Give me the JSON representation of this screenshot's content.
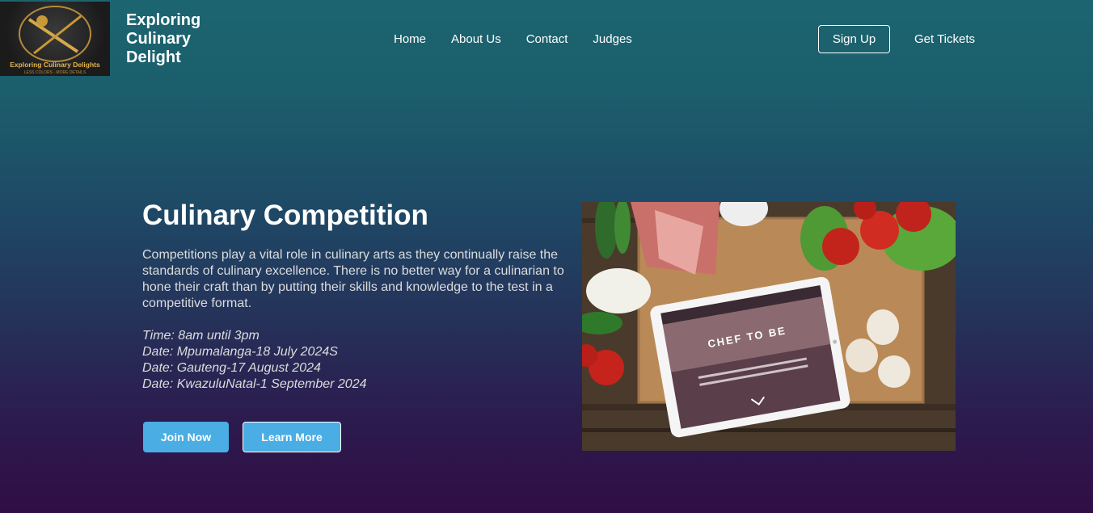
{
  "header": {
    "logo_text": "Exploring Culinary Delights",
    "logo_subtext": "LESS COLORS · MORE DETAILS",
    "brand_line1": "Exploring",
    "brand_line2": "Culinary",
    "brand_line3": "Delight",
    "nav": [
      {
        "label": "Home"
      },
      {
        "label": "About Us"
      },
      {
        "label": "Contact"
      },
      {
        "label": "Judges"
      }
    ],
    "signup_label": "Sign Up",
    "tickets_label": "Get Tickets"
  },
  "hero": {
    "title": "Culinary Competition",
    "description": "Competitions play a vital role in culinary arts as they continually raise the standards of culinary excellence. There is no better way for a culinarian to hone their craft than by putting their skills and knowledge to the test in a competitive format.",
    "details": [
      "Time: 8am until 3pm",
      "Date: Mpumalanga-18 July 2024S",
      "Date: Gauteng-17 August 2024",
      "Date: KwazuluNatal-1 September 2024"
    ],
    "join_label": "Join Now",
    "learn_label": "Learn More",
    "image_caption": "CHEF TO BE"
  },
  "colors": {
    "accent": "#4aade3",
    "gradient_top": "#1c6570",
    "gradient_bottom": "#300d45"
  }
}
